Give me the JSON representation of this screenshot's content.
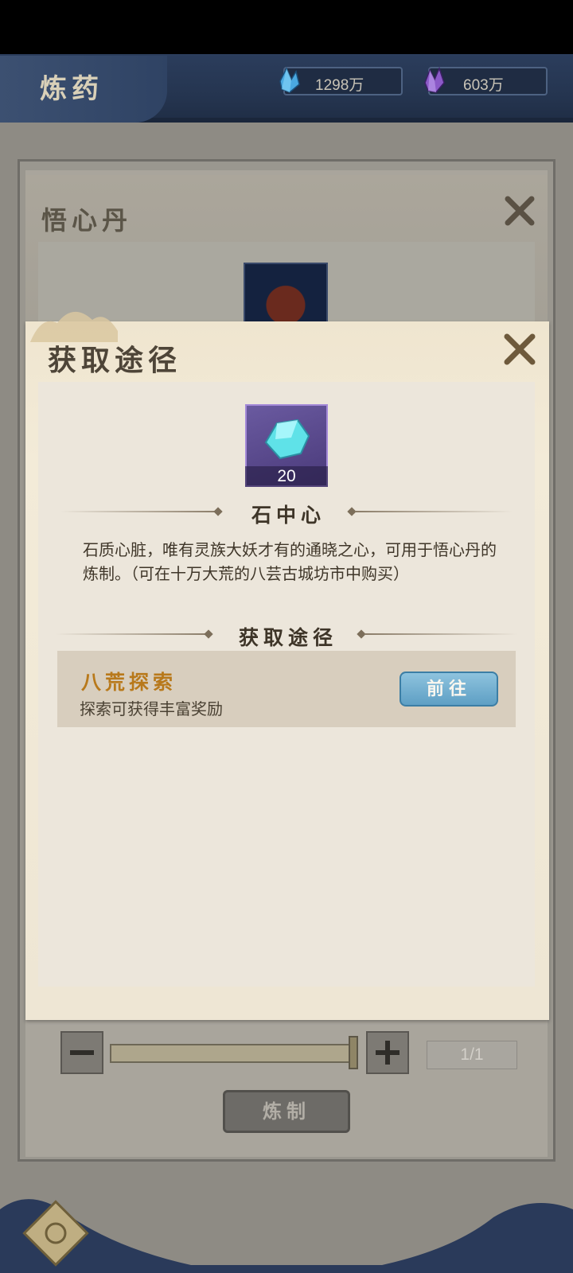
{
  "header": {
    "title": "炼药",
    "currencies": [
      {
        "icon": "blue-crystal-icon",
        "value": "1298万"
      },
      {
        "icon": "purple-crystal-icon",
        "value": "603万"
      }
    ]
  },
  "background_dialog": {
    "title": "悟心丹"
  },
  "popup": {
    "title": "获取途径",
    "item": {
      "icon": "stone-heart-icon",
      "count": "20",
      "name": "石中心",
      "description": "石质心脏，唯有灵族大妖才有的通晓之心，可用于悟心丹的炼制。（可在十万大荒的八芸古城坊市中购买）"
    },
    "section_title": "获取途径",
    "sources": [
      {
        "name": "八荒探索",
        "desc": "探索可获得丰富奖励",
        "button": "前往"
      }
    ]
  },
  "controls": {
    "quantity": "1/1",
    "slider_fraction": 1.0,
    "craft_button": "炼制"
  },
  "colors": {
    "header_bg": "#253550",
    "popup_bg": "#efe5cf",
    "source_name": "#b8791b",
    "go_button": "#6fa9cc"
  }
}
